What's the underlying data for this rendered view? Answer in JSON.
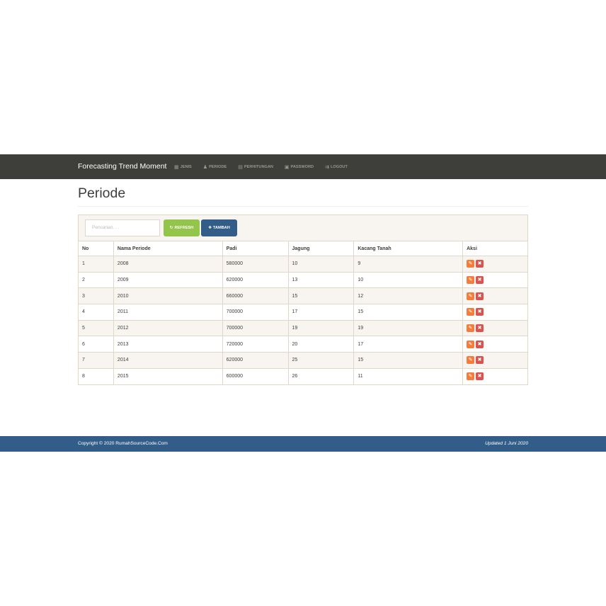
{
  "navbar": {
    "brand": "Forecasting Trend Moment",
    "items": [
      {
        "label": "JENIS",
        "icon": "grid-icon"
      },
      {
        "label": "PERIODE",
        "icon": "user-icon"
      },
      {
        "label": "PERHITUNGAN",
        "icon": "calendar-icon"
      },
      {
        "label": "PASSWORD",
        "icon": "lock-icon"
      },
      {
        "label": "LOGOUT",
        "icon": "logout-icon"
      }
    ]
  },
  "page": {
    "title": "Periode"
  },
  "toolbar": {
    "search_placeholder": "Pencarian. . .",
    "refresh_label": "REFRESH",
    "tambah_label": "TAMBAH"
  },
  "table": {
    "headers": [
      "No",
      "Nama Periode",
      "Padi",
      "Jagung",
      "Kacang Tanah",
      "Aksi"
    ],
    "rows": [
      [
        "1",
        "2008",
        "580000",
        "10",
        "9"
      ],
      [
        "2",
        "2009",
        "620000",
        "13",
        "10"
      ],
      [
        "3",
        "2010",
        "660000",
        "15",
        "12"
      ],
      [
        "4",
        "2011",
        "700000",
        "17",
        "15"
      ],
      [
        "5",
        "2012",
        "700000",
        "19",
        "19"
      ],
      [
        "6",
        "2013",
        "720000",
        "20",
        "17"
      ],
      [
        "7",
        "2014",
        "620000",
        "25",
        "15"
      ],
      [
        "8",
        "2015",
        "600000",
        "26",
        "11"
      ]
    ]
  },
  "footer": {
    "copyright": "Copyright © 2020 RumahSourceCode.Com",
    "updated": "Updated 1 Juni 2020"
  },
  "colors": {
    "navbar": "#3e3f3a",
    "footer": "#325d88",
    "refresh": "#93c54b",
    "tambah": "#325d88",
    "edit": "#f47c3c",
    "delete": "#d9534f"
  }
}
